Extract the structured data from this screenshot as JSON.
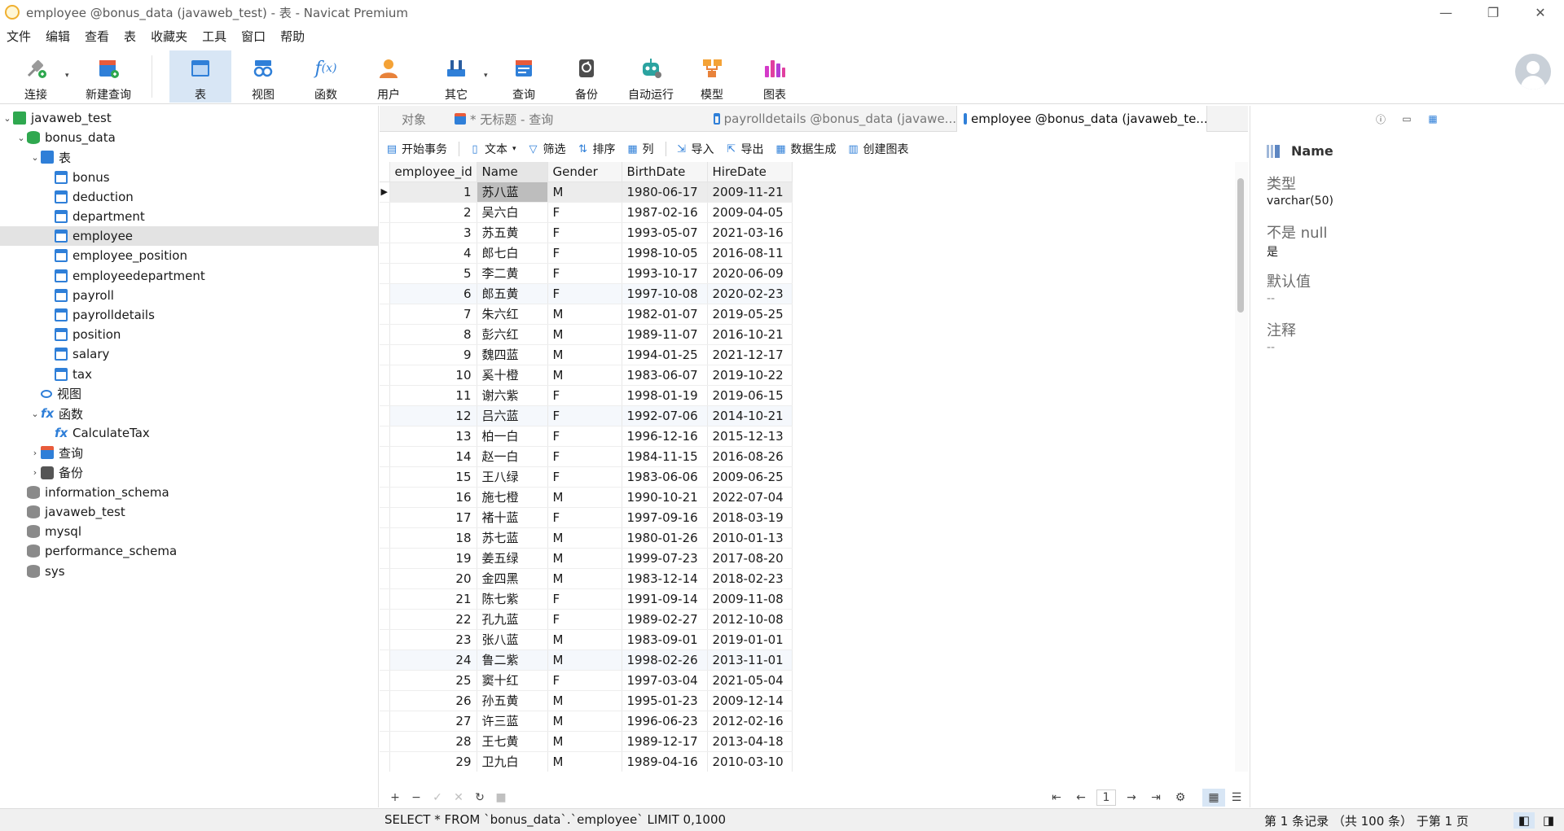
{
  "window": {
    "title": "employee @bonus_data (javaweb_test) - 表 - Navicat Premium",
    "min": "—",
    "max": "❐",
    "close": "✕"
  },
  "menu": [
    "文件",
    "编辑",
    "查看",
    "表",
    "收藏夹",
    "工具",
    "窗口",
    "帮助"
  ],
  "toolbar": {
    "buttons": [
      {
        "label": "连接",
        "icon": "plug-icon"
      },
      {
        "label": "新建查询",
        "icon": "new-query-icon"
      },
      {
        "label": "表",
        "icon": "table-icon",
        "active": true
      },
      {
        "label": "视图",
        "icon": "view-icon"
      },
      {
        "label": "函数",
        "icon": "function-icon"
      },
      {
        "label": "用户",
        "icon": "user-icon"
      },
      {
        "label": "其它",
        "icon": "tools-icon"
      },
      {
        "label": "查询",
        "icon": "query-icon"
      },
      {
        "label": "备份",
        "icon": "backup-icon"
      },
      {
        "label": "自动运行",
        "icon": "robot-icon"
      },
      {
        "label": "模型",
        "icon": "model-icon"
      },
      {
        "label": "图表",
        "icon": "chart-icon"
      }
    ]
  },
  "tree": [
    {
      "label": "javaweb_test",
      "level": 0,
      "toggle": "⌄",
      "icon": "conn"
    },
    {
      "label": "bonus_data",
      "level": 1,
      "toggle": "⌄",
      "icon": "db-green"
    },
    {
      "label": "表",
      "level": 2,
      "toggle": "⌄",
      "icon": "folder-table"
    },
    {
      "label": "bonus",
      "level": 3,
      "toggle": "",
      "icon": "table"
    },
    {
      "label": "deduction",
      "level": 3,
      "toggle": "",
      "icon": "table"
    },
    {
      "label": "department",
      "level": 3,
      "toggle": "",
      "icon": "table"
    },
    {
      "label": "employee",
      "level": 3,
      "toggle": "",
      "icon": "table",
      "selected": true
    },
    {
      "label": "employee_position",
      "level": 3,
      "toggle": "",
      "icon": "table"
    },
    {
      "label": "employeedepartment",
      "level": 3,
      "toggle": "",
      "icon": "table"
    },
    {
      "label": "payroll",
      "level": 3,
      "toggle": "",
      "icon": "table"
    },
    {
      "label": "payrolldetails",
      "level": 3,
      "toggle": "",
      "icon": "table"
    },
    {
      "label": "position",
      "level": 3,
      "toggle": "",
      "icon": "table"
    },
    {
      "label": "salary",
      "level": 3,
      "toggle": "",
      "icon": "table"
    },
    {
      "label": "tax",
      "level": 3,
      "toggle": "",
      "icon": "table"
    },
    {
      "label": "视图",
      "level": 2,
      "toggle": "",
      "icon": "view"
    },
    {
      "label": "函数",
      "level": 2,
      "toggle": "⌄",
      "icon": "func"
    },
    {
      "label": "CalculateTax",
      "level": 3,
      "toggle": "",
      "icon": "func"
    },
    {
      "label": "查询",
      "level": 2,
      "toggle": "›",
      "icon": "query"
    },
    {
      "label": "备份",
      "level": 2,
      "toggle": "›",
      "icon": "backup"
    },
    {
      "label": "information_schema",
      "level": 1,
      "toggle": "",
      "icon": "db-gray"
    },
    {
      "label": "javaweb_test",
      "level": 1,
      "toggle": "",
      "icon": "db-gray"
    },
    {
      "label": "mysql",
      "level": 1,
      "toggle": "",
      "icon": "db-gray"
    },
    {
      "label": "performance_schema",
      "level": 1,
      "toggle": "",
      "icon": "db-gray"
    },
    {
      "label": "sys",
      "level": 1,
      "toggle": "",
      "icon": "db-gray"
    }
  ],
  "tabs": [
    {
      "label": "对象",
      "active": false
    },
    {
      "label": "* 无标题 - 查询",
      "active": false
    },
    {
      "label": "payrolldetails @bonus_data (javawe...",
      "active": false
    },
    {
      "label": "employee @bonus_data (javaweb_te...",
      "active": true
    }
  ],
  "subtoolbar": [
    "开始事务",
    "文本",
    "筛选",
    "排序",
    "列",
    "导入",
    "导出",
    "数据生成",
    "创建图表"
  ],
  "grid": {
    "columns": [
      "employee_id",
      "Name",
      "Gender",
      "BirthDate",
      "HireDate"
    ],
    "rows": [
      [
        "1",
        "苏八蓝",
        "M",
        "1980-06-17",
        "2009-11-21"
      ],
      [
        "2",
        "吴六白",
        "F",
        "1987-02-16",
        "2009-04-05"
      ],
      [
        "3",
        "苏五黄",
        "F",
        "1993-05-07",
        "2021-03-16"
      ],
      [
        "4",
        "郎七白",
        "F",
        "1998-10-05",
        "2016-08-11"
      ],
      [
        "5",
        "李二黄",
        "F",
        "1993-10-17",
        "2020-06-09"
      ],
      [
        "6",
        "郎五黄",
        "F",
        "1997-10-08",
        "2020-02-23"
      ],
      [
        "7",
        "朱六红",
        "M",
        "1982-01-07",
        "2019-05-25"
      ],
      [
        "8",
        "彭六红",
        "M",
        "1989-11-07",
        "2016-10-21"
      ],
      [
        "9",
        "魏四蓝",
        "M",
        "1994-01-25",
        "2021-12-17"
      ],
      [
        "10",
        "奚十橙",
        "M",
        "1983-06-07",
        "2019-10-22"
      ],
      [
        "11",
        "谢六紫",
        "F",
        "1998-01-19",
        "2019-06-15"
      ],
      [
        "12",
        "吕六蓝",
        "F",
        "1992-07-06",
        "2014-10-21"
      ],
      [
        "13",
        "柏一白",
        "F",
        "1996-12-16",
        "2015-12-13"
      ],
      [
        "14",
        "赵一白",
        "F",
        "1984-11-15",
        "2016-08-26"
      ],
      [
        "15",
        "王八绿",
        "F",
        "1983-06-06",
        "2009-06-25"
      ],
      [
        "16",
        "施七橙",
        "M",
        "1990-10-21",
        "2022-07-04"
      ],
      [
        "17",
        "褚十蓝",
        "F",
        "1997-09-16",
        "2018-03-19"
      ],
      [
        "18",
        "苏七蓝",
        "M",
        "1980-01-26",
        "2010-01-13"
      ],
      [
        "19",
        "姜五绿",
        "M",
        "1999-07-23",
        "2017-08-20"
      ],
      [
        "20",
        "金四黑",
        "M",
        "1983-12-14",
        "2018-02-23"
      ],
      [
        "21",
        "陈七紫",
        "F",
        "1991-09-14",
        "2009-11-08"
      ],
      [
        "22",
        "孔九蓝",
        "F",
        "1989-02-27",
        "2012-10-08"
      ],
      [
        "23",
        "张八蓝",
        "M",
        "1983-09-01",
        "2019-01-01"
      ],
      [
        "24",
        "鲁二紫",
        "M",
        "1998-02-26",
        "2013-11-01"
      ],
      [
        "25",
        "窦十红",
        "F",
        "1997-03-04",
        "2021-05-04"
      ],
      [
        "26",
        "孙五黄",
        "M",
        "1995-01-23",
        "2009-12-14"
      ],
      [
        "27",
        "许三蓝",
        "M",
        "1996-06-23",
        "2012-02-16"
      ],
      [
        "28",
        "王七黄",
        "M",
        "1989-12-17",
        "2013-04-18"
      ],
      [
        "29",
        "卫九白",
        "M",
        "1989-04-16",
        "2010-03-10"
      ]
    ]
  },
  "gridbar": {
    "add": "+",
    "remove": "−",
    "apply": "✓",
    "discard": "✕",
    "refresh": "↻",
    "stop": "■",
    "page": "1"
  },
  "rightpanel": {
    "field_name": "Name",
    "type_label": "类型",
    "type_value": "varchar(50)",
    "notnull_label": "不是 null",
    "notnull_value": "是",
    "default_label": "默认值",
    "default_value": "--",
    "comment_label": "注释",
    "comment_value": "--"
  },
  "status": {
    "sql": "SELECT * FROM `bonus_data`.`employee` LIMIT 0,1000",
    "records": "第 1 条记录 （共 100 条） 于第 1 页"
  },
  "colors": {
    "accent": "#2f7fd8",
    "selected_bg": "#d8e6f5"
  }
}
